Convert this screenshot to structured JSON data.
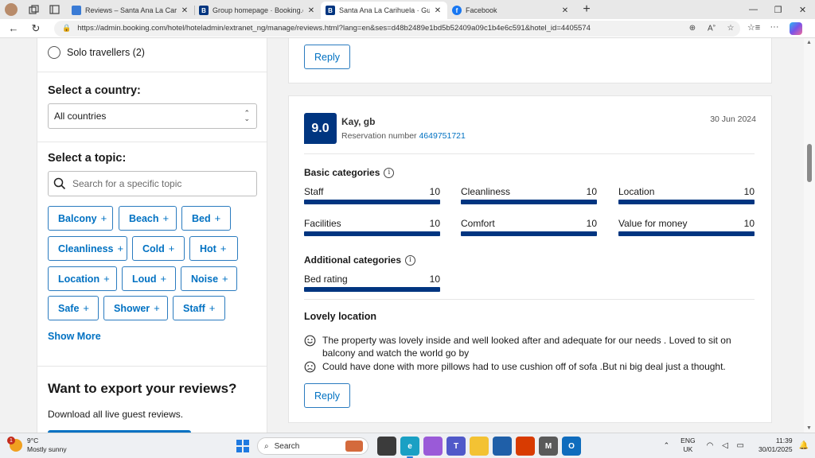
{
  "browser": {
    "tabs": [
      {
        "label": "Reviews – Santa Ana La Carihuela",
        "favicon_color": "#3a7bd5",
        "favicon_text": "",
        "active": false
      },
      {
        "label": "Group homepage · Booking.com",
        "favicon_color": "#003580",
        "favicon_text": "B",
        "active": false
      },
      {
        "label": "Santa Ana La Carihuela · Guest re",
        "favicon_color": "#003580",
        "favicon_text": "B",
        "active": true
      },
      {
        "label": "Facebook",
        "favicon_color": "#1877f2",
        "favicon_text": "f",
        "active": false
      }
    ],
    "url": "https://admin.booking.com/hotel/hoteladmin/extranet_ng/manage/reviews.html?lang=en&ses=d48b2489e1bd5b52409a09c1b4e6c591&hotel_id=4405574"
  },
  "filters": {
    "radio_label": "Solo travellers (2)",
    "country_title": "Select a country:",
    "country_value": "All countries",
    "topic_title": "Select a topic:",
    "topic_placeholder": "Search for a specific topic",
    "topics": [
      "Balcony",
      "Beach",
      "Bed",
      "Cleanliness",
      "Cold",
      "Hot",
      "Location",
      "Loud",
      "Noise",
      "Safe",
      "Shower",
      "Staff"
    ],
    "plus_symbol": "+",
    "show_more": "Show More"
  },
  "export": {
    "title": "Want to export your reviews?",
    "subtitle": "Download all live guest reviews."
  },
  "previous_review": {
    "reply_label": "Reply"
  },
  "review": {
    "score": "9.0",
    "guest": "Kay, gb",
    "reservation_label": "Reservation number",
    "reservation_number": "4649751721",
    "date": "30 Jun 2024",
    "basic_title": "Basic categories",
    "basic": [
      {
        "name": "Staff",
        "score": "10",
        "fill": 1.0
      },
      {
        "name": "Cleanliness",
        "score": "10",
        "fill": 1.0
      },
      {
        "name": "Location",
        "score": "10",
        "fill": 1.0
      },
      {
        "name": "Facilities",
        "score": "10",
        "fill": 1.0
      },
      {
        "name": "Comfort",
        "score": "10",
        "fill": 1.0
      },
      {
        "name": "Value for money",
        "score": "10",
        "fill": 1.0
      }
    ],
    "additional_title": "Additional categories",
    "additional": [
      {
        "name": "Bed rating",
        "score": "10",
        "fill": 1.0
      }
    ],
    "headline": "Lovely location",
    "positive": "The property was lovely inside and well looked after and adequate for our needs . Loved to sit on balcony and watch the world go by",
    "negative": "Could have done with more pillows had to use cushion off of sofa .But ni big deal just a thought.",
    "reply_label": "Reply",
    "bar_color": "#003580"
  },
  "taskbar": {
    "weather_temp": "9°C",
    "weather_desc": "Mostly sunny",
    "weather_badge": "1",
    "search_label": "Search",
    "lang_top": "ENG",
    "lang_bottom": "UK",
    "time": "11:39",
    "date": "30/01/2025"
  }
}
